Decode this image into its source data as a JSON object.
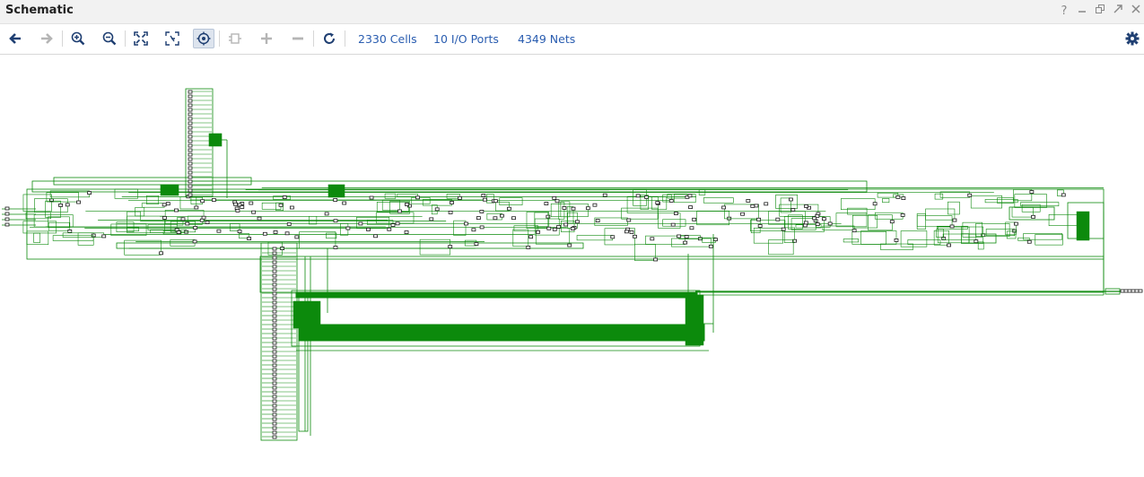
{
  "window": {
    "title": "Schematic",
    "controls": [
      "help-icon",
      "minimize-icon",
      "restore-icon",
      "maximize-icon",
      "close-icon"
    ]
  },
  "toolbar": {
    "buttons": [
      {
        "name": "back-button",
        "icon": "arrow-left-icon",
        "enabled": true
      },
      {
        "name": "forward-button",
        "icon": "arrow-right-icon",
        "enabled": false
      },
      {
        "name": "zoom-in-button",
        "icon": "zoom-in-icon",
        "enabled": true
      },
      {
        "name": "zoom-out-button",
        "icon": "zoom-out-icon",
        "enabled": true
      },
      {
        "name": "zoom-fit-button",
        "icon": "fit-icon",
        "enabled": true
      },
      {
        "name": "zoom-selection-button",
        "icon": "fit-selection-icon",
        "enabled": true
      },
      {
        "name": "auto-fit-toggle",
        "icon": "crosshair-icon",
        "enabled": true,
        "active": true
      },
      {
        "name": "cell-button",
        "icon": "cell-icon",
        "enabled": false
      },
      {
        "name": "expand-button",
        "icon": "plus-icon",
        "enabled": false
      },
      {
        "name": "collapse-button",
        "icon": "minus-icon",
        "enabled": false
      },
      {
        "name": "regenerate-button",
        "icon": "refresh-icon",
        "enabled": true
      }
    ],
    "stats": {
      "cells": "2330 Cells",
      "ports": "10 I/O Ports",
      "nets": "4349 Nets"
    },
    "settings_icon": "gear-icon"
  },
  "colors": {
    "accent": "#2a5db0",
    "wire": "#0c8a0c",
    "cell": "#1a1a1a",
    "disabled": "#b5b5b5"
  }
}
